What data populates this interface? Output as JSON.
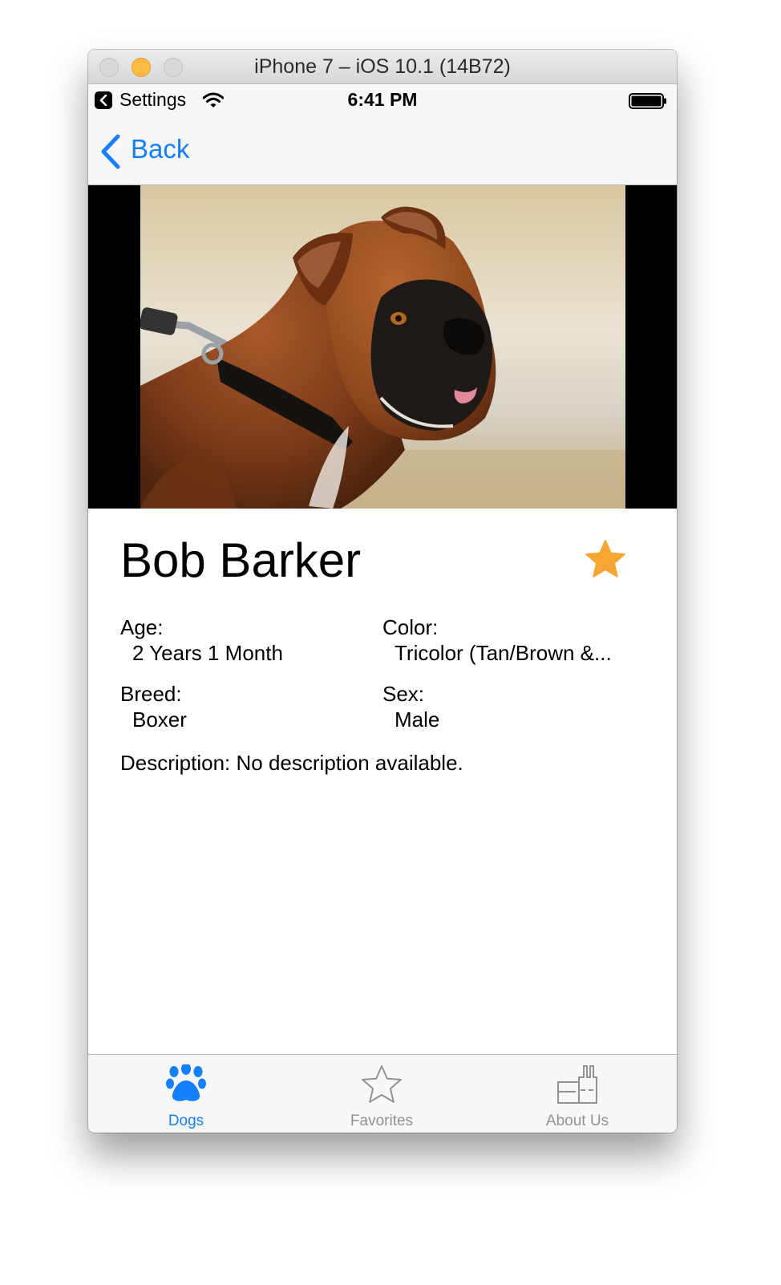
{
  "window": {
    "title": "iPhone 7 – iOS 10.1 (14B72)"
  },
  "status_bar": {
    "back_to_app": "Settings",
    "time": "6:41 PM",
    "wifi_icon": "wifi-icon",
    "battery_icon": "battery-icon",
    "battery_level": 1.0
  },
  "nav_bar": {
    "back_label": "Back",
    "back_icon": "chevron-left-icon"
  },
  "dog": {
    "photo": "boxer-dog-photo",
    "name": "Bob Barker",
    "favorited": true,
    "favorite_icon": "star-filled-icon",
    "age_label": "Age:",
    "age_value": "2 Years 1 Month",
    "color_label": "Color:",
    "color_value": "Tricolor (Tan/Brown &...",
    "breed_label": "Breed:",
    "breed_value": "Boxer",
    "sex_label": "Sex:",
    "sex_value": "Male",
    "description": "Description: No description available."
  },
  "tab_bar": {
    "tabs": [
      {
        "label": "Dogs",
        "icon": "paw-icon",
        "selected": true
      },
      {
        "label": "Favorites",
        "icon": "star-outline-icon",
        "selected": false
      },
      {
        "label": "About Us",
        "icon": "factory-icon",
        "selected": false
      }
    ]
  },
  "colors": {
    "tint": "#147efb",
    "favorite_star": "#f7a634",
    "tab_inactive": "#929292"
  }
}
